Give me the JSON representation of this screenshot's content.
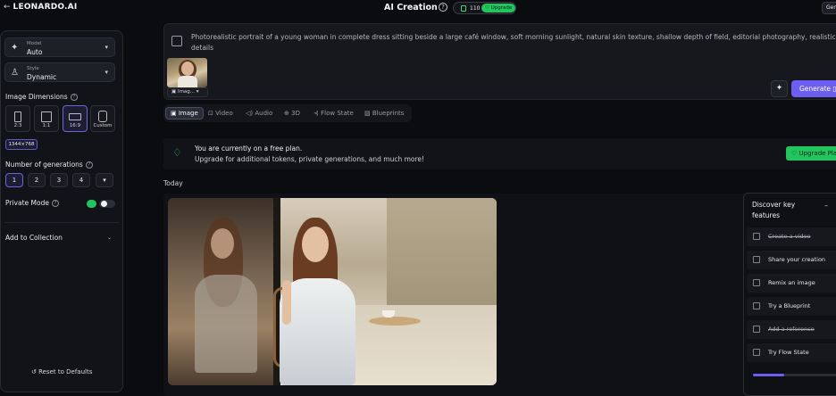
{
  "header": {
    "logo_text": "LEONARDO.AI",
    "page_title": "AI Creation",
    "token_count": "110",
    "upgrade_label": "Upgrade",
    "generate_top_label": "Gene"
  },
  "sidebar": {
    "model_label": "Model",
    "model_value": "Auto",
    "style_label": "Style",
    "style_value": "Dynamic",
    "image_dimensions_label": "Image Dimensions",
    "dimensions": [
      {
        "label": "2:3"
      },
      {
        "label": "1:1"
      },
      {
        "label": "16:9",
        "selected": true
      },
      {
        "label": "Custom"
      }
    ],
    "size_chip": "1344×768",
    "generations_label": "Number of generations",
    "generation_options": [
      "1",
      "2",
      "3",
      "4"
    ],
    "selected_generation": "1",
    "private_mode_label": "Private Mode",
    "private_mode_on": false,
    "add_to_collection_label": "Add to Collection",
    "reset_label": "Reset to Defaults"
  },
  "prompt": {
    "text": "Photorealistic portrait of a young woman  in complete dress sitting beside a large café window, soft morning sunlight, natural skin texture, shallow depth of field, editorial photography, realistic details",
    "image_tag_label": "Imag...",
    "generate_label": "Generate"
  },
  "tabs": [
    {
      "label": "Image",
      "active": true
    },
    {
      "label": "Video"
    },
    {
      "label": "Audio"
    },
    {
      "label": "3D"
    },
    {
      "label": "Flow State"
    },
    {
      "label": "Blueprints"
    }
  ],
  "banner": {
    "line1": "You are currently on a free plan.",
    "line2": "Upgrade for additional tokens, private generations, and much more!",
    "button_label": "Upgrade Plan"
  },
  "feed": {
    "section_label": "Today"
  },
  "discover": {
    "title": "Discover key features",
    "items": [
      {
        "label": "Create a video",
        "done": true
      },
      {
        "label": "Share your creation",
        "done": false
      },
      {
        "label": "Remix an image",
        "done": false
      },
      {
        "label": "Try a Blueprint",
        "done": false
      },
      {
        "label": "Add a reference",
        "done": true
      },
      {
        "label": "Try Flow State",
        "done": false
      }
    ],
    "progress_fraction": 0.35
  },
  "colors": {
    "accent": "#6d5ef2",
    "success": "#22c55e",
    "background": "#0b0c10"
  }
}
